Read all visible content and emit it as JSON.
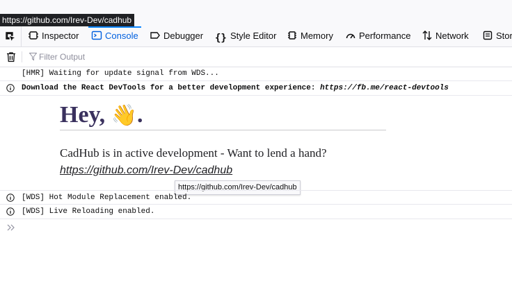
{
  "status_url": "https://github.com/Irev-Dev/cadhub",
  "toolbar": {
    "tabs": [
      {
        "label": "Inspector",
        "icon": "inspector-icon"
      },
      {
        "label": "Console",
        "icon": "console-icon",
        "active": true
      },
      {
        "label": "Debugger",
        "icon": "debugger-icon"
      },
      {
        "label": "Style Editor",
        "icon": "style-editor-icon"
      },
      {
        "label": "Memory",
        "icon": "memory-icon"
      },
      {
        "label": "Performance",
        "icon": "performance-icon"
      },
      {
        "label": "Network",
        "icon": "network-icon"
      },
      {
        "label": "Stor",
        "icon": "storage-icon"
      }
    ]
  },
  "filter": {
    "placeholder": "Filter Output"
  },
  "messages": {
    "hmr": "[HMR] Waiting for update signal from WDS...",
    "devtools_bold": "Download the React DevTools for a better development experience: ",
    "devtools_link": "https://fb.me/react-devtools",
    "wds_hot": "[WDS] Hot Module Replacement enabled.",
    "wds_live": "[WDS] Live Reloading enabled."
  },
  "rendered_log": {
    "heading": "Hey, ",
    "heading_emoji": "👋",
    "heading_end": ".",
    "text": "CadHub is in active development - Want to lend a hand?",
    "link": "https://github.com/Irev-Dev/cadhub"
  },
  "link_tooltip": "https://github.com/Irev-Dev/cadhub",
  "colors": {
    "accent": "#0060df",
    "heading": "#3a315e",
    "toolbar_bg": "#f9f9fb"
  }
}
